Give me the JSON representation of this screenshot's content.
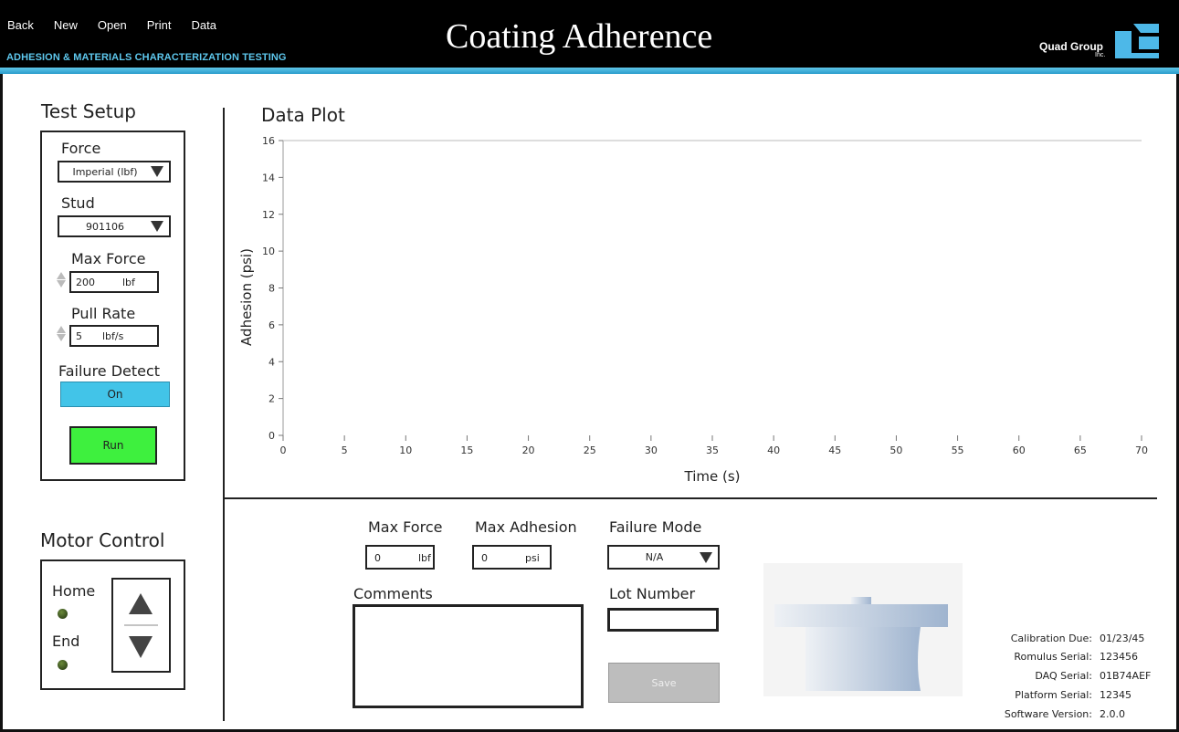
{
  "header": {
    "menu": [
      "Back",
      "New",
      "Open",
      "Print",
      "Data"
    ],
    "subtitle": "ADHESION & MATERIALS CHARACTERIZATION TESTING",
    "title": "Coating Adherence",
    "brand": "Quad Group",
    "brand_suffix": "Inc.",
    "accent": "#5ec8ee"
  },
  "test_setup": {
    "heading": "Test Setup",
    "force_label": "Force",
    "force_value": "Imperial (lbf)",
    "stud_label": "Stud",
    "stud_value": "901106",
    "max_force_label": "Max Force",
    "max_force_value": "200",
    "max_force_unit": "lbf",
    "pull_rate_label": "Pull Rate",
    "pull_rate_value": "5",
    "pull_rate_unit": "lbf/s",
    "failure_detect_label": "Failure Detect",
    "failure_detect_value": "On",
    "run_label": "Run"
  },
  "motor_control": {
    "heading": "Motor Control",
    "home_label": "Home",
    "end_label": "End"
  },
  "results": {
    "max_force_label": "Max Force",
    "max_force_value": "0",
    "max_force_unit": "lbf",
    "max_adhesion_label": "Max Adhesion",
    "max_adhesion_value": "0",
    "max_adhesion_unit": "psi",
    "failure_mode_label": "Failure Mode",
    "failure_mode_value": "N/A",
    "comments_label": "Comments",
    "comments_value": "",
    "lot_number_label": "Lot Number",
    "lot_number_value": "",
    "save_label": "Save"
  },
  "info": [
    {
      "key": "Calibration Due:",
      "value": "01/23/45"
    },
    {
      "key": "Romulus Serial:",
      "value": "123456"
    },
    {
      "key": "DAQ Serial:",
      "value": "01B74AEF"
    },
    {
      "key": "Platform Serial:",
      "value": "12345"
    },
    {
      "key": "Software Version:",
      "value": "2.0.0"
    }
  ],
  "chart_data": {
    "type": "line",
    "title": "Data Plot",
    "xlabel": "Time (s)",
    "ylabel": "Adhesion (psi)",
    "xlim": [
      0,
      70
    ],
    "ylim": [
      0,
      16
    ],
    "xticks": [
      0,
      5,
      10,
      15,
      20,
      25,
      30,
      35,
      40,
      45,
      50,
      55,
      60,
      65,
      70
    ],
    "yticks": [
      0,
      2,
      4,
      6,
      8,
      10,
      12,
      14,
      16
    ],
    "series": [],
    "grid": false
  }
}
